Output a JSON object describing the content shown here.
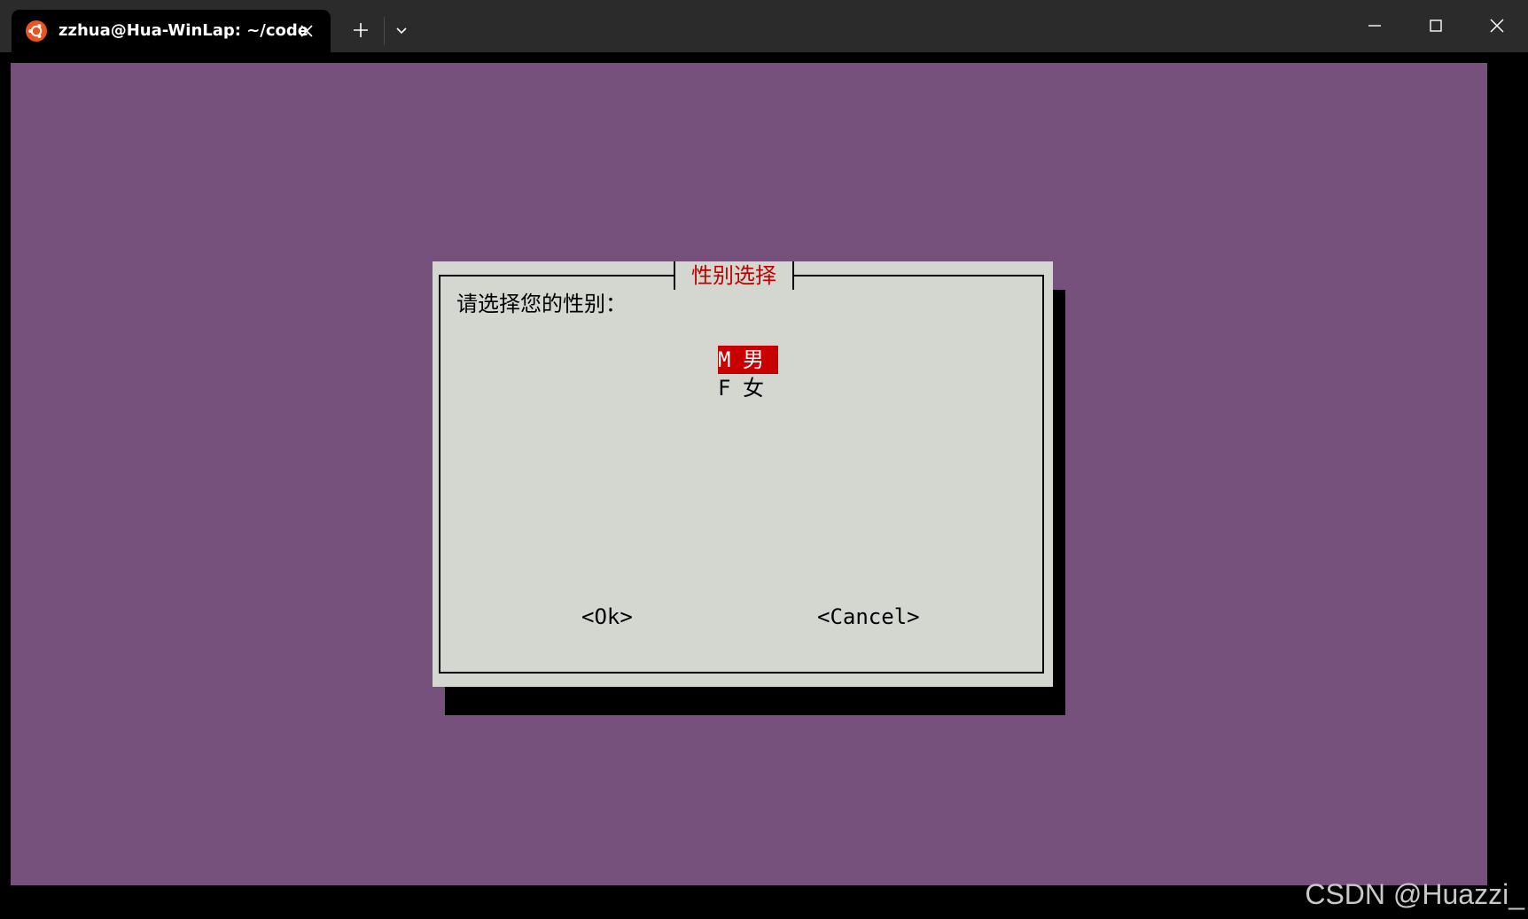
{
  "window": {
    "tab_title": "zzhua@Hua-WinLap: ~/code",
    "tab_icon": "ubuntu-icon",
    "close_tab_icon": "close-icon",
    "new_tab_icon": "plus-icon",
    "dropdown_icon": "chevron-down-icon",
    "controls": {
      "minimize_icon": "minimize-icon",
      "maximize_icon": "maximize-icon",
      "close_icon": "close-icon"
    }
  },
  "colors": {
    "terminal_background": "#76517c",
    "dialog_background": "#d4d7d0",
    "title_color": "#c00000",
    "selection_background": "#c80000",
    "titlebar": "#2b2b2b",
    "ubuntu_orange": "#e95420"
  },
  "dialog": {
    "title": "性别选择",
    "prompt": "请选择您的性别：",
    "items": [
      {
        "tag": "M",
        "label": "男",
        "selected": true
      },
      {
        "tag": "F",
        "label": "女",
        "selected": false
      }
    ],
    "buttons": {
      "ok": "<Ok>",
      "cancel": "<Cancel>"
    }
  },
  "watermark": "CSDN @Huazzi_"
}
